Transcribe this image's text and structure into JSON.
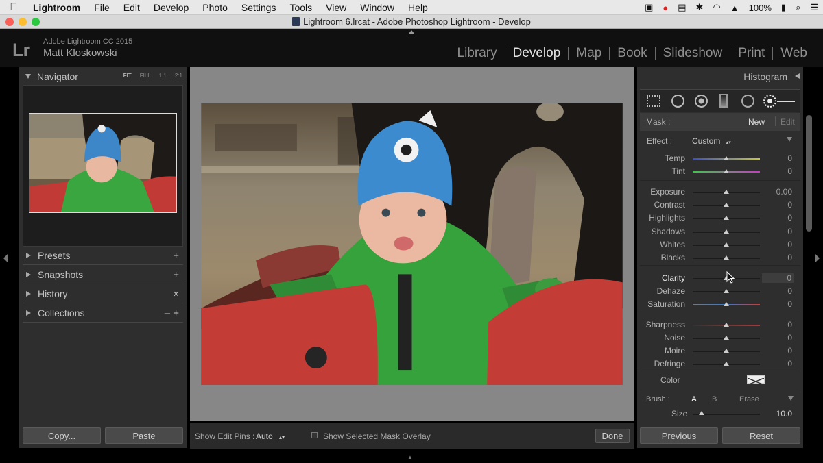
{
  "menubar": {
    "app_name": "Lightroom",
    "items": [
      "File",
      "Edit",
      "Develop",
      "Photo",
      "Settings",
      "Tools",
      "View",
      "Window",
      "Help"
    ],
    "battery": "100%"
  },
  "window": {
    "title": "Lightroom 6.lrcat - Adobe Photoshop Lightroom - Develop"
  },
  "identity": {
    "logo": "Lr",
    "product": "Adobe Lightroom CC 2015",
    "user": "Matt Kloskowski"
  },
  "modules": [
    "Library",
    "Develop",
    "Map",
    "Book",
    "Slideshow",
    "Print",
    "Web"
  ],
  "active_module": "Develop",
  "left_panel": {
    "navigator": {
      "title": "Navigator",
      "zoom": [
        "FIT",
        "FILL",
        "1:1",
        "2:1"
      ]
    },
    "panels": [
      {
        "label": "Presets",
        "action": "+"
      },
      {
        "label": "Snapshots",
        "action": "+"
      },
      {
        "label": "History",
        "action": "×"
      },
      {
        "label": "Collections",
        "action": "– +"
      }
    ],
    "copy_label": "Copy...",
    "paste_label": "Paste"
  },
  "toolbar": {
    "edit_pins_label": "Show Edit Pins :",
    "edit_pins_value": "Auto",
    "mask_overlay_label": "Show Selected Mask Overlay",
    "done_label": "Done"
  },
  "right_panel": {
    "histogram": "Histogram",
    "mask_label": "Mask :",
    "mask_new": "New",
    "mask_edit": "Edit",
    "effect_label": "Effect :",
    "effect_value": "Custom",
    "sliders": [
      {
        "label": "Temp",
        "value": "0"
      },
      {
        "label": "Tint",
        "value": "0"
      },
      {
        "label": "Exposure",
        "value": "0.00"
      },
      {
        "label": "Contrast",
        "value": "0"
      },
      {
        "label": "Highlights",
        "value": "0"
      },
      {
        "label": "Shadows",
        "value": "0"
      },
      {
        "label": "Whites",
        "value": "0"
      },
      {
        "label": "Blacks",
        "value": "0"
      },
      {
        "label": "Clarity",
        "value": "0"
      },
      {
        "label": "Dehaze",
        "value": "0"
      },
      {
        "label": "Saturation",
        "value": "0"
      },
      {
        "label": "Sharpness",
        "value": "0"
      },
      {
        "label": "Noise",
        "value": "0"
      },
      {
        "label": "Moire",
        "value": "0"
      },
      {
        "label": "Defringe",
        "value": "0"
      }
    ],
    "color_label": "Color",
    "brush_label": "Brush :",
    "brush_a": "A",
    "brush_b": "B",
    "brush_erase": "Erase",
    "size_label": "Size",
    "size_value": "10.0",
    "previous_label": "Previous",
    "reset_label": "Reset"
  }
}
